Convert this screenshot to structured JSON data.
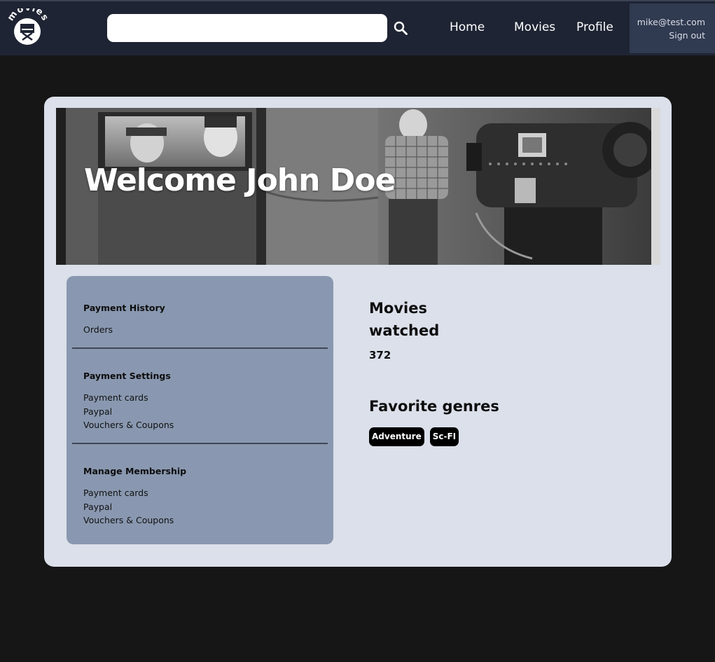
{
  "header": {
    "logo_text": "movies",
    "search": {
      "value": "",
      "placeholder": ""
    },
    "nav": {
      "home": "Home",
      "movies": "Movies",
      "profile": "Profile"
    },
    "account": {
      "email": "mike@test.com",
      "sign_out": "Sign out"
    }
  },
  "hero": {
    "title": "Welcome John Doe"
  },
  "sidebar": {
    "sections": [
      {
        "heading": "Payment History",
        "items": [
          "Orders"
        ]
      },
      {
        "heading": "Payment Settings",
        "items": [
          "Payment cards",
          "Paypal",
          "Vouchers & Coupons"
        ]
      },
      {
        "heading": "Manage Membership",
        "items": [
          "Payment cards",
          "Paypal",
          "Vouchers & Coupons"
        ]
      }
    ]
  },
  "stats": {
    "movies_watched_label": "Movies watched",
    "movies_watched_value": "372",
    "favorite_genres_label": "Favorite genres",
    "genres": [
      "Adventure",
      "Sc-FI"
    ]
  },
  "colors": {
    "page_bg": "#161616",
    "navbar_bg": "#1e2433",
    "account_bg": "#303a50",
    "card_bg": "#dbe0ea",
    "sidebar_bg": "#8998b0",
    "tag_bg": "#000000"
  }
}
